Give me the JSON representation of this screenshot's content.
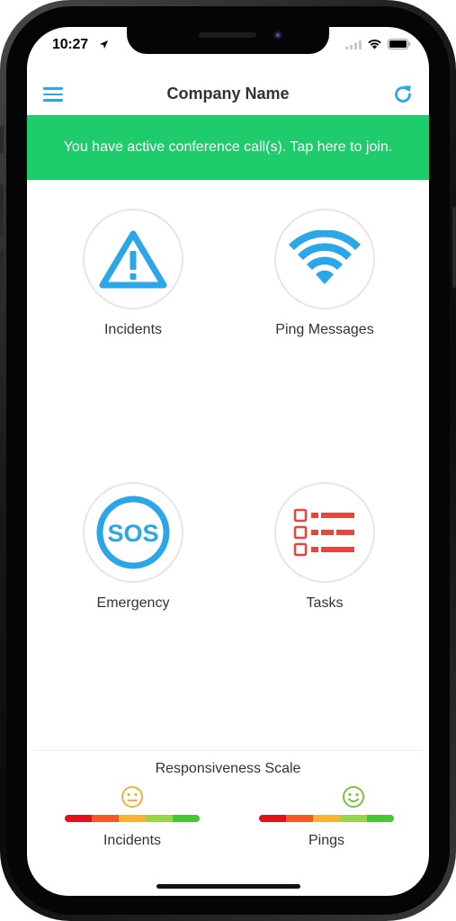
{
  "status_bar": {
    "time": "10:27",
    "icons": [
      "location-arrow-icon",
      "signal-icon",
      "wifi-icon",
      "battery-icon"
    ]
  },
  "nav": {
    "title": "Company Name",
    "menu_icon": "hamburger-menu-icon",
    "refresh_icon": "refresh-icon"
  },
  "banner": {
    "text": "You have active conference call(s). Tap here to join.",
    "color": "#1fcc6b"
  },
  "tiles": [
    {
      "label": "Incidents",
      "icon": "warning-triangle-icon",
      "color": "#2ba6e8"
    },
    {
      "label": "Ping Messages",
      "icon": "wifi-signal-icon",
      "color": "#2ba6e8"
    },
    {
      "label": "Emergency",
      "icon": "sos-icon",
      "color": "#2ba6e8"
    },
    {
      "label": "Tasks",
      "icon": "checklist-icon",
      "color": "#e8453c"
    }
  ],
  "responsiveness": {
    "title": "Responsiveness Scale",
    "scale_colors": [
      "#d9151b",
      "#f0592a",
      "#f7b23b",
      "#9bd14f",
      "#4cc13a"
    ],
    "items": [
      {
        "label": "Incidents",
        "face": "neutral-face-icon",
        "face_color": "#f2b233",
        "level": 0.5
      },
      {
        "label": "Pings",
        "face": "smiling-face-icon",
        "face_color": "#7dc242",
        "level": 0.7
      }
    ]
  },
  "colors": {
    "accent": "#2ba6e8",
    "banner_green": "#1fcc6b",
    "task_red": "#e8453c"
  }
}
